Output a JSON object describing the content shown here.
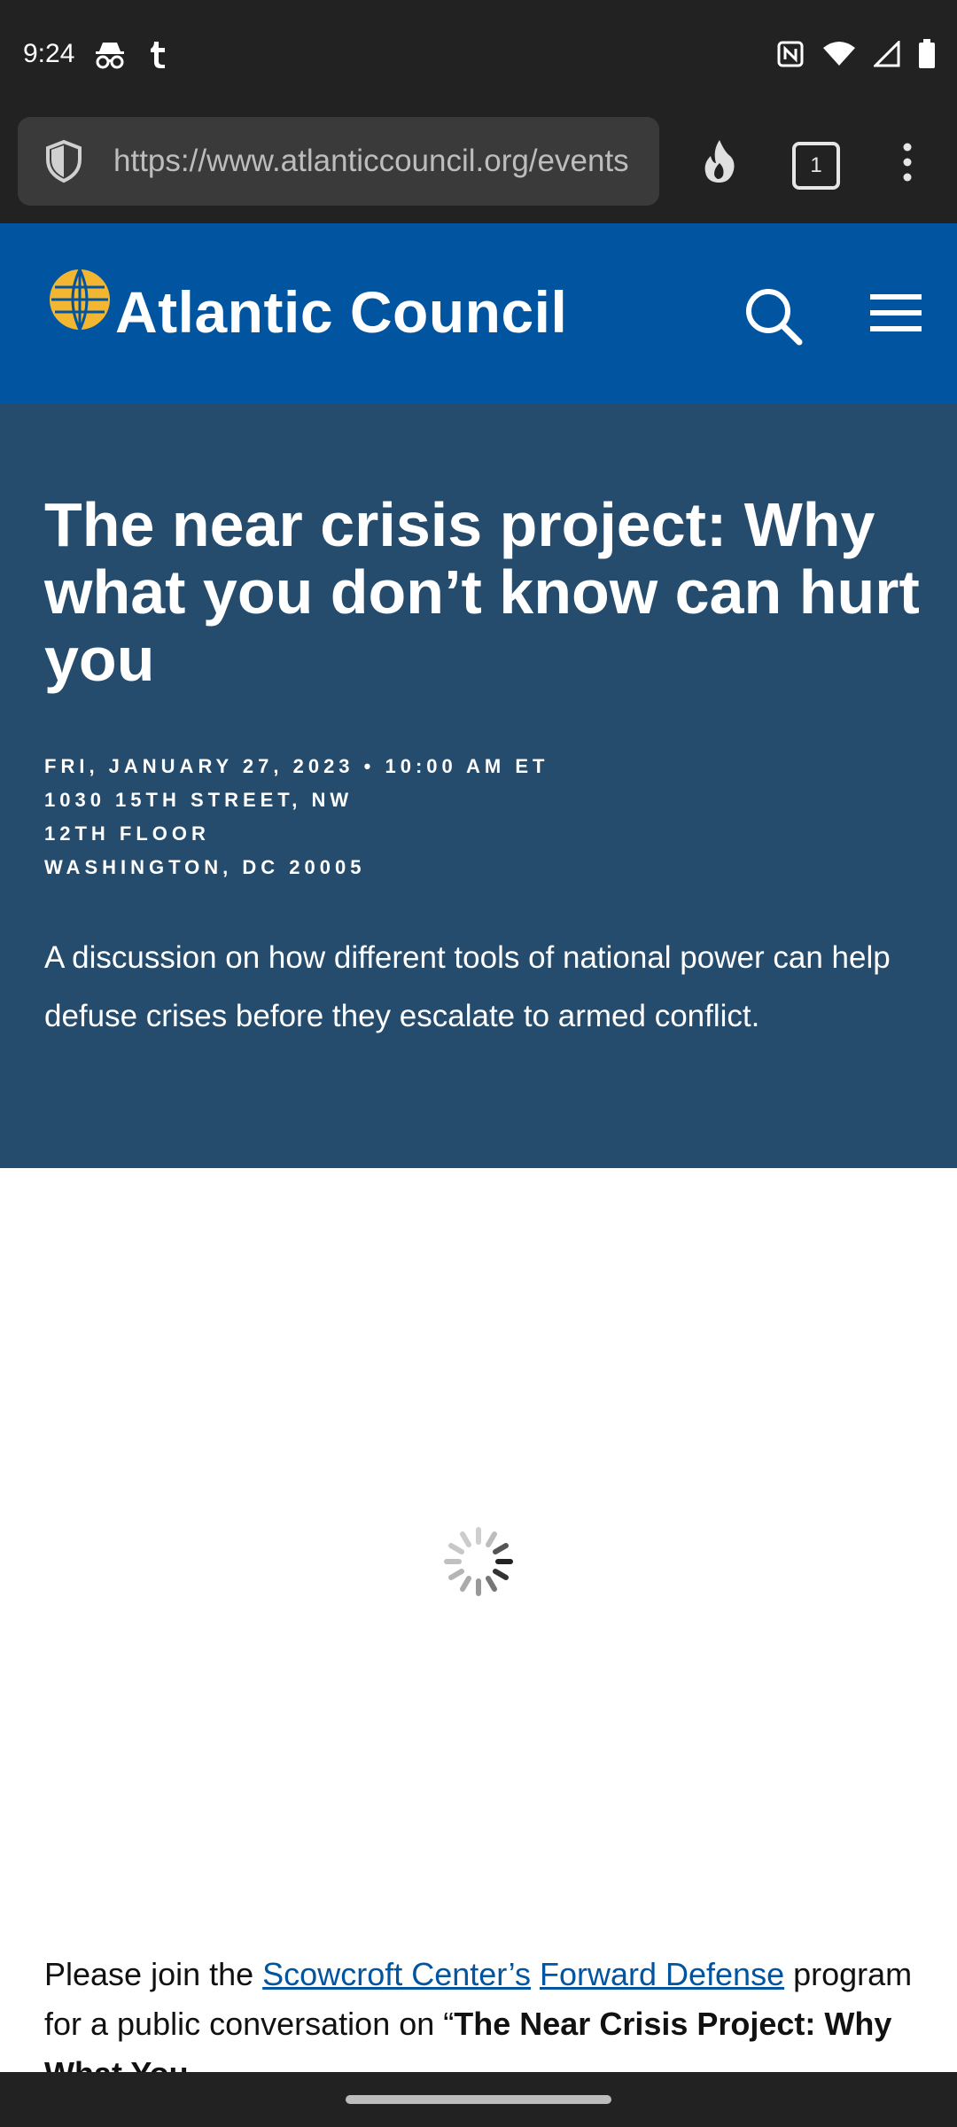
{
  "status_bar": {
    "time": "9:24",
    "left_icons": [
      "incognito-icon",
      "tumblr-icon"
    ],
    "right_icons": [
      "nfc-icon",
      "wifi-icon",
      "cell-signal-icon",
      "battery-icon"
    ]
  },
  "browser": {
    "url": "https://www.atlanticcouncil.org/events",
    "tab_count": "1"
  },
  "site": {
    "name": "Atlantic Council"
  },
  "event": {
    "title": "The near crisis project: Why what you don’t know can hurt you",
    "date_line": "FRI, JANUARY 27, 2023 • 10:00 AM ET",
    "address_line1": "1030 15TH STREET, NW",
    "address_line2": "12TH FLOOR",
    "address_line3": "WASHINGTON, DC 20005",
    "description": "A discussion on how different tools of national power can help defuse crises before they escalate to armed conflict."
  },
  "body": {
    "intro_prefix": "Please join the ",
    "link1": "Scowcroft Center’s",
    "space": " ",
    "link2": "Forward Defense",
    "intro_suffix": " program for a public conversation on “",
    "bold_title": "The Near Crisis Project: Why What You"
  },
  "colors": {
    "header_blue": "#01549f",
    "hero_blue": "#254c6d",
    "logo_gold": "#f2b630"
  }
}
